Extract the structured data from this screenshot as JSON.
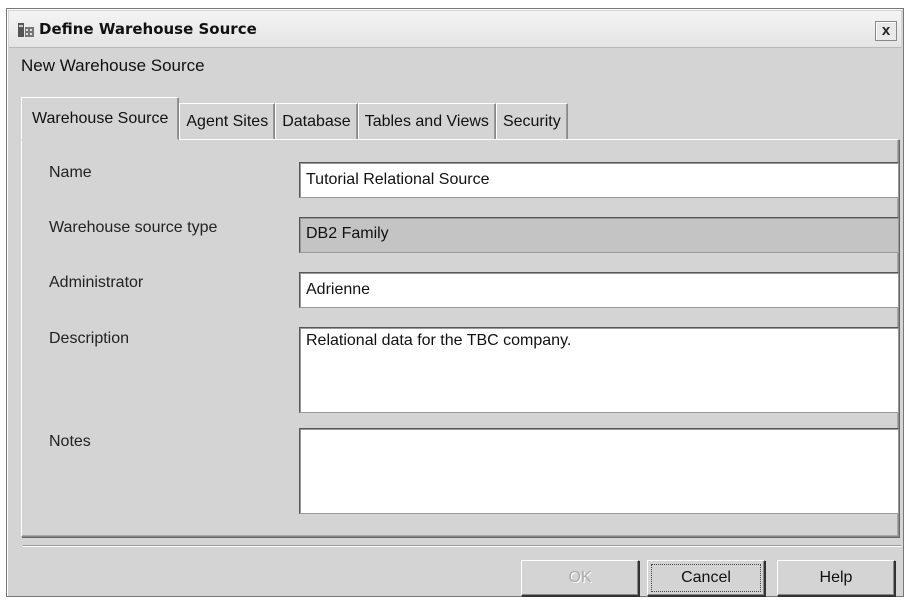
{
  "window": {
    "title": "Define Warehouse Source",
    "icon": "warehouse-app-icon",
    "close_label": "x"
  },
  "subtitle": "New Warehouse Source",
  "tabs": [
    {
      "label": "Warehouse Source",
      "active": true
    },
    {
      "label": "Agent Sites",
      "active": false
    },
    {
      "label": "Database",
      "active": false
    },
    {
      "label": "Tables and Views",
      "active": false
    },
    {
      "label": "Security",
      "active": false
    }
  ],
  "form": {
    "name": {
      "label": "Name",
      "value": "Tutorial Relational Source"
    },
    "source_type": {
      "label": "Warehouse source type",
      "value": "DB2 Family"
    },
    "administrator": {
      "label": "Administrator",
      "value": "Adrienne"
    },
    "description": {
      "label": "Description",
      "value": "Relational data for the TBC company."
    },
    "notes": {
      "label": "Notes",
      "value": ""
    }
  },
  "buttons": {
    "ok": "OK",
    "cancel": "Cancel",
    "help": "Help"
  }
}
